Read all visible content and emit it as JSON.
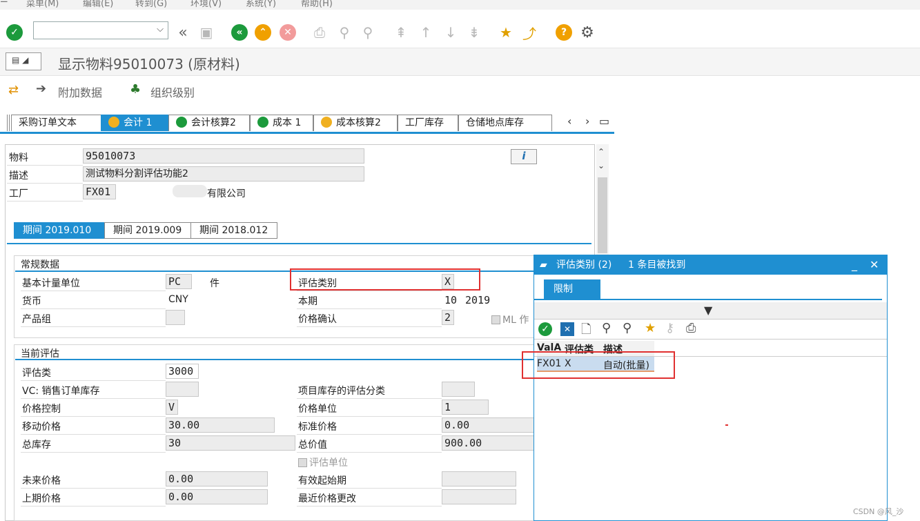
{
  "menu": [
    "菜单(M)",
    "编辑(E)",
    "转到(G)",
    "环境(V)",
    "系统(Y)",
    "帮助(H)"
  ],
  "title": "显示物料95010073 (原材料)",
  "appbar": {
    "additional": "附加数据",
    "org": "组织级别"
  },
  "tabs": [
    "采购订单文本",
    "会计 1",
    "会计核算2",
    "成本 1",
    "成本核算2",
    "工厂库存",
    "仓储地点库存"
  ],
  "header": {
    "material_label": "物料",
    "material": "95010073",
    "desc_label": "描述",
    "desc": "测试物料分割评估功能2",
    "plant_label": "工厂",
    "plant": "FX01",
    "plant_name": "有限公司"
  },
  "periods": [
    "期间 2019.010",
    "期间 2019.009",
    "期间 2018.012"
  ],
  "general": {
    "title": "常规数据",
    "uom_label": "基本计量单位",
    "uom": "PC",
    "uom_text": "件",
    "currency_label": "货币",
    "currency": "CNY",
    "division_label": "产品组",
    "valcat_label": "评估类别",
    "valcat": "X",
    "period_label": "本期",
    "period_month": "10",
    "period_year": "2019",
    "price_det_label": "价格确认",
    "price_det": "2",
    "ml_label": "ML 作"
  },
  "valuation": {
    "title": "当前评估",
    "class_label": "评估类",
    "class": "3000",
    "vc_label": "VC: 销售订单库存",
    "proj_label": "项目库存的评估分类",
    "pricectl_label": "价格控制",
    "pricectl": "V",
    "priceunit_label": "价格单位",
    "priceunit": "1",
    "mavg_label": "移动价格",
    "mavg": "30.00",
    "std_label": "标准价格",
    "std": "0.00",
    "stock_label": "总库存",
    "stock": "30",
    "total_label": "总价值",
    "total": "900.00",
    "valunit_label": "评估单位",
    "future_label": "未来价格",
    "future": "0.00",
    "valid_label": "有效起始期",
    "prev_label": "上期价格",
    "prev": "0.00",
    "last_change_label": "最近价格更改"
  },
  "popup": {
    "title": "评估类别 (2)",
    "found": "1 条目被找到",
    "tab": "限制",
    "cols": [
      "ValA",
      "评估类",
      "描述"
    ],
    "row": {
      "vala": "FX01",
      "type": "X",
      "desc": "自动(批量)"
    }
  },
  "watermark": "CSDN @风_沙"
}
